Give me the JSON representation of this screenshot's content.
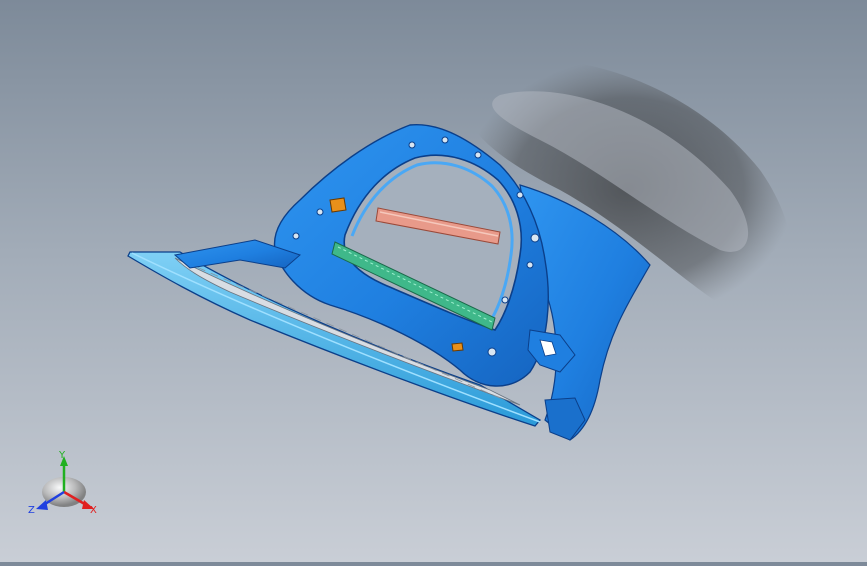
{
  "viewport": {
    "background_top": "#7d8a99",
    "background_bottom": "#c9ced6",
    "model": {
      "part": "liftgate-inner-panel",
      "body_color": "#1f7fe0",
      "edge_color": "#0b3f8a",
      "reinforcement_color": "#e89a8a",
      "seal_strip_color": "#3fb88a"
    },
    "triad": {
      "x_label": "X",
      "y_label": "Y",
      "z_label": "Z",
      "x_color": "#e02020",
      "y_color": "#20b020",
      "z_color": "#2040e0"
    }
  }
}
